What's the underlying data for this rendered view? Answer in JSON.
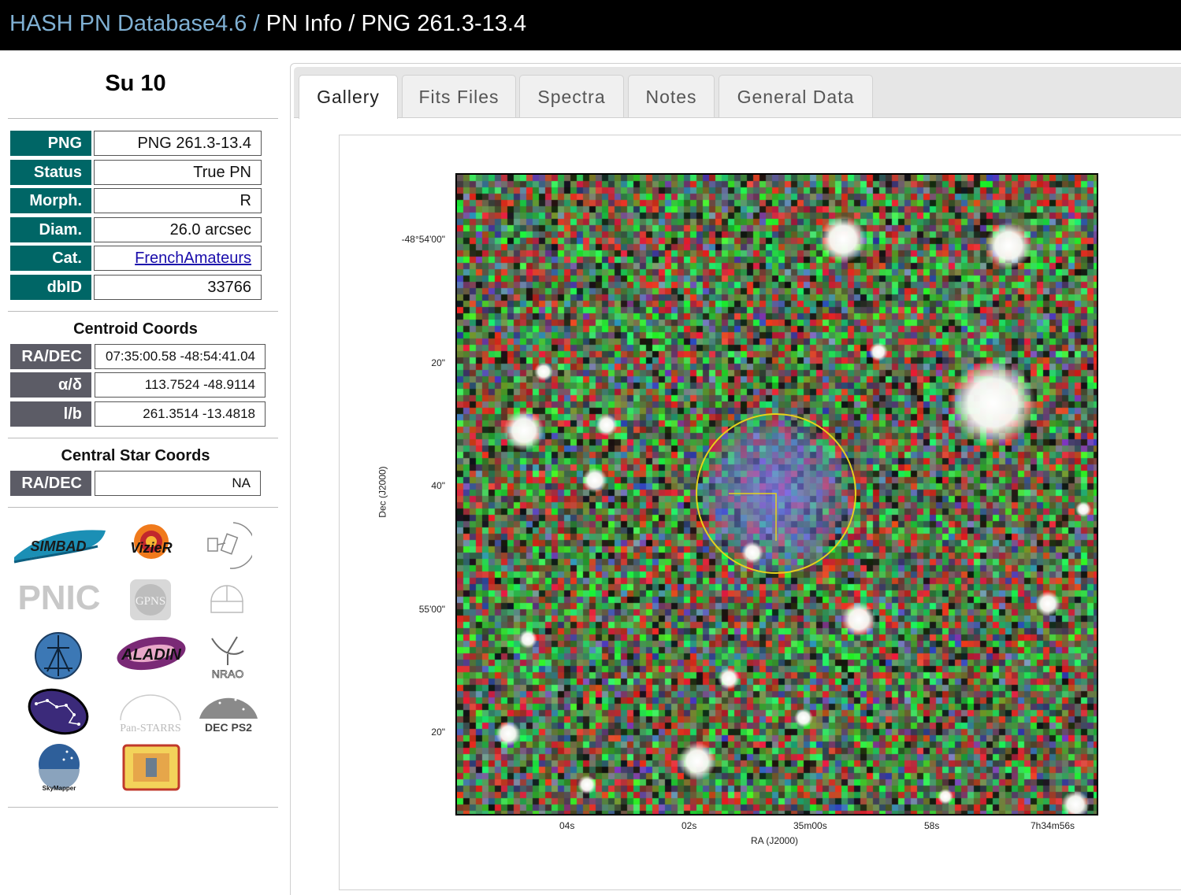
{
  "header": {
    "breadcrumb_root": "HASH PN Database4.6",
    "sep1": " / ",
    "breadcrumb_section": "PN Info",
    "sep2": " / ",
    "breadcrumb_current": "PNG 261.3-13.4"
  },
  "object": {
    "name": "Su 10",
    "fields": [
      {
        "label": "PNG",
        "value": "PNG 261.3-13.4"
      },
      {
        "label": "Status",
        "value": "True PN"
      },
      {
        "label": "Morph.",
        "value": "R"
      },
      {
        "label": "Diam.",
        "value": "26.0 arcsec"
      },
      {
        "label": "Cat.",
        "value": "FrenchAmateurs"
      },
      {
        "label": "dbID",
        "value": "33766"
      }
    ]
  },
  "centroid": {
    "title": "Centroid Coords",
    "rows": [
      {
        "label": "RA/DEC",
        "value": "07:35:00.58 -48:54:41.04"
      },
      {
        "label": "α/δ",
        "value": "113.7524 -48.9114"
      },
      {
        "label": "l/b",
        "value": "261.3514 -13.4818"
      }
    ]
  },
  "central_star": {
    "title": "Central Star Coords",
    "rows": [
      {
        "label": "RA/DEC",
        "value": "NA"
      }
    ]
  },
  "logos": {
    "simbad": "SIMBAD",
    "vizier": "VizieR",
    "pnic": "PNIC",
    "gpns": "GPNS",
    "aladin": "ALADIN",
    "nrao": "NRAO",
    "panstarrs": "Pan-STARRS",
    "decaps": "DEC PS2",
    "skymapper": "SkyMapper"
  },
  "tabs": [
    {
      "label": "Gallery",
      "active": true
    },
    {
      "label": "Fits Files",
      "active": false
    },
    {
      "label": "Spectra",
      "active": false
    },
    {
      "label": "Notes",
      "active": false
    },
    {
      "label": "General Data",
      "active": false
    }
  ],
  "image": {
    "y_ticks": [
      "-48°54'00\"",
      "20\"",
      "40\"",
      "55'00\"",
      "20\""
    ],
    "x_ticks": [
      "04s",
      "02s",
      "35m00s",
      "58s",
      "7h34m56s"
    ],
    "x_label": "RA (J2000)",
    "y_label": "Dec (J2000)"
  },
  "colors": {
    "topbar": "#000000",
    "teal_label": "#006666",
    "grey_label": "#5c5c66",
    "link": "#1a0dab",
    "breadcrumb_link": "#7fb0d3",
    "aperture_circle": "#e6d21a"
  }
}
